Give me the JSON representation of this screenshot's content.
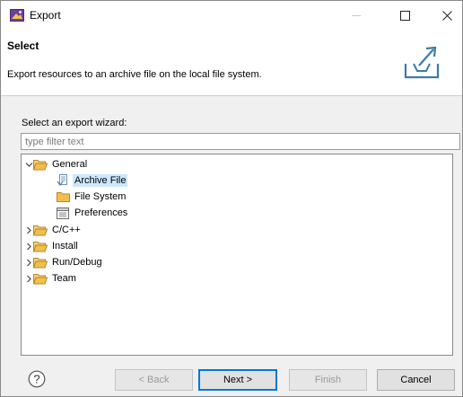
{
  "window": {
    "title": "Export"
  },
  "header": {
    "title": "Select",
    "description": "Export resources to an archive file on the local file system."
  },
  "wizard": {
    "label": "Select an export wizard:",
    "filter_placeholder": "type filter text",
    "tree": [
      {
        "label": "General",
        "expanded": true,
        "icon": "folder-open-icon"
      },
      {
        "label": "Archive File",
        "icon": "archive-file-icon",
        "selected": true,
        "parent": "General"
      },
      {
        "label": "File System",
        "icon": "folder-icon",
        "parent": "General"
      },
      {
        "label": "Preferences",
        "icon": "preferences-icon",
        "parent": "General"
      },
      {
        "label": "C/C++",
        "expanded": false,
        "icon": "folder-open-icon"
      },
      {
        "label": "Install",
        "expanded": false,
        "icon": "folder-open-icon"
      },
      {
        "label": "Run/Debug",
        "expanded": false,
        "icon": "folder-open-icon"
      },
      {
        "label": "Team",
        "expanded": false,
        "icon": "folder-open-icon"
      }
    ]
  },
  "buttons": {
    "back": "< Back",
    "next": "Next >",
    "finish": "Finish",
    "cancel": "Cancel"
  },
  "colors": {
    "selection": "#cce8ff",
    "default_button_border": "#0078d7",
    "folder": "#e8b84a"
  }
}
